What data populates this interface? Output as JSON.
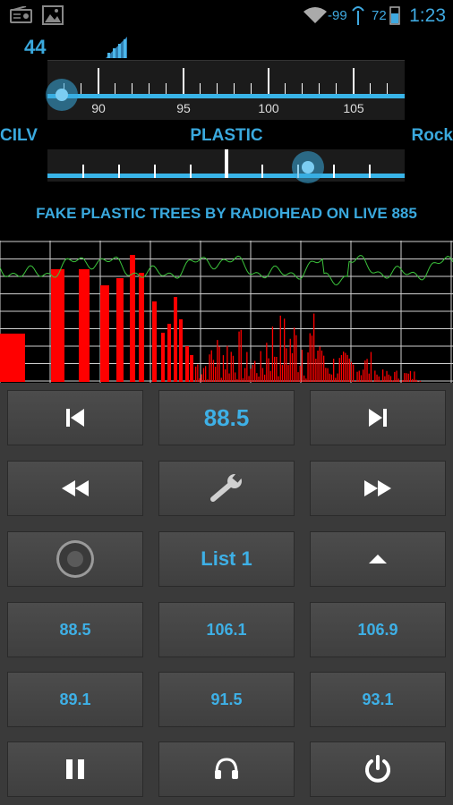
{
  "status_bar": {
    "signal_strength": "-99",
    "battery": "72",
    "time": "1:23"
  },
  "tuner": {
    "rssi_value": "44",
    "frequency_ticks": [
      "90",
      "95",
      "100",
      "105"
    ],
    "frequency_knob_position": 0.04
  },
  "genre": {
    "left_label": "CILV",
    "center_label": "PLASTIC",
    "right_label": "Rock",
    "knob_position": 0.73
  },
  "now_playing": "FAKE PLASTIC TREES BY RADIOHEAD ON LIVE 885",
  "controls": {
    "row1": {
      "prev_icon": "skip-previous-icon",
      "frequency": "88.5",
      "next_icon": "skip-next-icon"
    },
    "row2": {
      "rewind_icon": "rewind-icon",
      "settings_icon": "wrench-icon",
      "forward_icon": "fast-forward-icon"
    },
    "row3": {
      "record_icon": "record-icon",
      "list": "List 1",
      "up_icon": "chevron-up-icon"
    },
    "presets_row1": [
      "88.5",
      "106.1",
      "106.9"
    ],
    "presets_row2": [
      "89.1",
      "91.5",
      "93.1"
    ],
    "row6": {
      "pause_icon": "pause-icon",
      "headset_icon": "headset-icon",
      "power_icon": "power-icon"
    }
  },
  "colors": {
    "accent": "#3aa9de",
    "spectrum_bars": "#ff0000",
    "waveform": "#3cc43c",
    "button_bg": "#474747"
  }
}
